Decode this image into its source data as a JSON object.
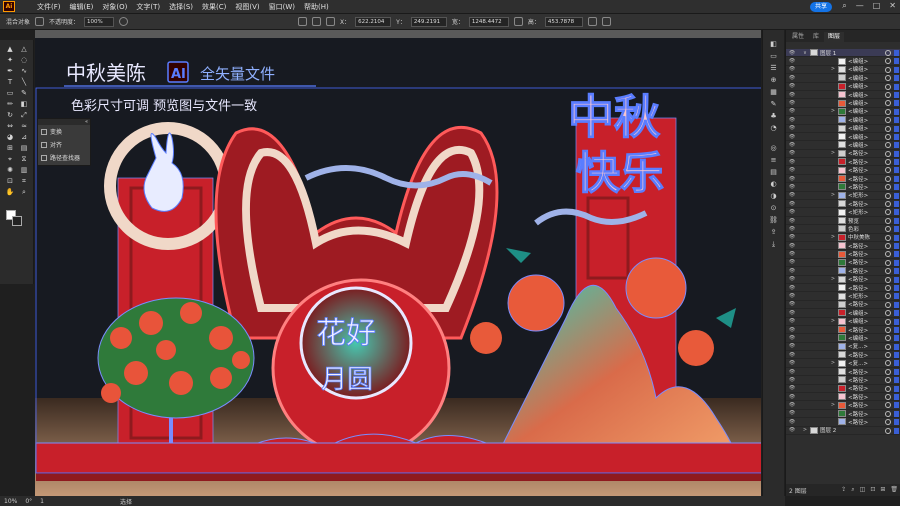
{
  "app": {
    "logo": "Ai"
  },
  "menu": [
    "文件(F)",
    "编辑(E)",
    "对象(O)",
    "文字(T)",
    "选择(S)",
    "效果(C)",
    "视图(V)",
    "窗口(W)",
    "帮助(H)"
  ],
  "share_button": "共享",
  "window_controls": {
    "search": "⌕",
    "minimize": "—",
    "maximize": "□",
    "close": "✕"
  },
  "control_bar": {
    "selection_label": "混合对象",
    "opacity_label": "不透明度：",
    "opacity_value": "100%",
    "x_label": "X：",
    "x_value": "622.2104",
    "y_label": "Y：",
    "y_value": "249.2191",
    "w_label": "宽：",
    "w_value": "1248.4472",
    "h_label": "高：",
    "h_value": "453.7878"
  },
  "float_panel": {
    "items": [
      "变换",
      "对齐",
      "路径查找器"
    ]
  },
  "artwork": {
    "brand": "中秋美陈",
    "ai_badge": "AI",
    "vector_label": "全矢量文件",
    "subtitle": "色彩尺寸可调  预览图与文件一致",
    "headline_line1": "中秋",
    "headline_line2": "快乐",
    "center_text_1": "花好",
    "center_text_2": "月圆"
  },
  "layers_panel": {
    "tabs": [
      "属性",
      "库",
      "图层"
    ],
    "rows": [
      {
        "name": "图层 1",
        "indent": false,
        "arrow": "∨"
      },
      {
        "name": "<编组>",
        "indent": true
      },
      {
        "name": "<编组>",
        "indent": true
      },
      {
        "name": "<编组>",
        "indent": true
      },
      {
        "name": "<编组>",
        "indent": true
      },
      {
        "name": "<编组>",
        "indent": true
      },
      {
        "name": "<编组>",
        "indent": true
      },
      {
        "name": "<编组>",
        "indent": true
      },
      {
        "name": "<编组>",
        "indent": true
      },
      {
        "name": "<编组>",
        "indent": true
      },
      {
        "name": "<编组>",
        "indent": true
      },
      {
        "name": "<编组>",
        "indent": true
      },
      {
        "name": "<路径>",
        "indent": true
      },
      {
        "name": "<路径>",
        "indent": true
      },
      {
        "name": "<路径>",
        "indent": true
      },
      {
        "name": "<路径>",
        "indent": true
      },
      {
        "name": "<路径>",
        "indent": true
      },
      {
        "name": "<矩形>",
        "indent": true
      },
      {
        "name": "<路径>",
        "indent": true
      },
      {
        "name": "<矩形>",
        "indent": true
      },
      {
        "name": "预览",
        "indent": true
      },
      {
        "name": "色彩",
        "indent": true
      },
      {
        "name": "中秋美陈",
        "indent": true
      },
      {
        "name": "<路径>",
        "indent": true
      },
      {
        "name": "<路径>",
        "indent": true
      },
      {
        "name": "<路径>",
        "indent": true
      },
      {
        "name": "<路径>",
        "indent": true
      },
      {
        "name": "<路径>",
        "indent": true
      },
      {
        "name": "<路径>",
        "indent": true
      },
      {
        "name": "<矩形>",
        "indent": true
      },
      {
        "name": "<路径>",
        "indent": true
      },
      {
        "name": "<编组>",
        "indent": true
      },
      {
        "name": "<编组>",
        "indent": true
      },
      {
        "name": "<路径>",
        "indent": true
      },
      {
        "name": "<编组>",
        "indent": true
      },
      {
        "name": "<复...>",
        "indent": true
      },
      {
        "name": "<路径>",
        "indent": true
      },
      {
        "name": "<复...>",
        "indent": true
      },
      {
        "name": "<路径>",
        "indent": true
      },
      {
        "name": "<路径>",
        "indent": true
      },
      {
        "name": "<路径>",
        "indent": true
      },
      {
        "name": "<路径>",
        "indent": true
      },
      {
        "name": "<路径>",
        "indent": true
      },
      {
        "name": "<路径>",
        "indent": true
      },
      {
        "name": "<路径>",
        "indent": true
      },
      {
        "name": "图层 2",
        "indent": false,
        "arrow": ">"
      }
    ],
    "footer_label": "2 图层"
  },
  "status_bar": {
    "zoom": "10%",
    "rotation": "0°",
    "artboard": "1",
    "tool": "选择"
  },
  "colors": {
    "accent": "#1473e6",
    "selection": "#3a5fd6",
    "stage_red": "#c8202a",
    "backdrop": "#171a21"
  }
}
